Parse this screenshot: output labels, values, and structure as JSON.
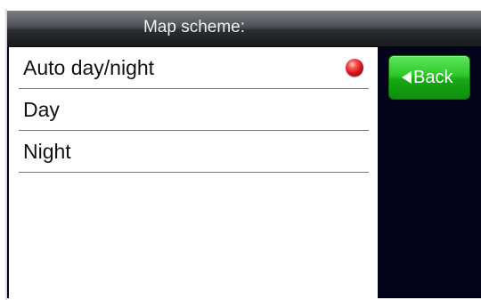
{
  "header": {
    "title": "Map scheme:"
  },
  "options": [
    {
      "label": "Auto day/night",
      "selected": true
    },
    {
      "label": "Day",
      "selected": false
    },
    {
      "label": "Night",
      "selected": false
    }
  ],
  "back_button": {
    "label": "Back",
    "icon": "left-triangle-icon"
  },
  "colors": {
    "background": "#02021a",
    "accent_green": "#1fb61c",
    "selected_indicator": "#d0161a"
  }
}
